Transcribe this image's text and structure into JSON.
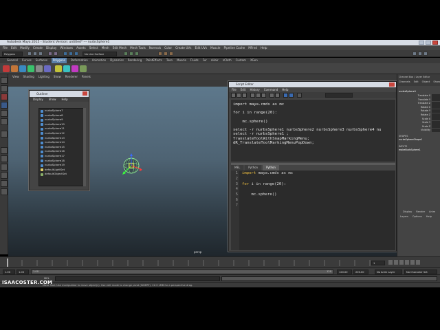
{
  "app": {
    "title": "Autodesk Maya 2015 - Student Version: untitled* --- nurbsSphere1"
  },
  "menubar": [
    "File",
    "Edit",
    "Modify",
    "Create",
    "Display",
    "Windows",
    "Assets",
    "Select",
    "Mesh",
    "Edit Mesh",
    "Mesh Tools",
    "Normals",
    "Color",
    "Create UVs",
    "Edit UVs",
    "Muscle",
    "Pipeline Cache",
    "MFrnd",
    "Help"
  ],
  "statusline": {
    "mode": "Polygons",
    "field_hint": "No Live Surface"
  },
  "shelf_tabs": {
    "items": [
      "General",
      "Curves",
      "Surfaces",
      "Polygons",
      "Deformation",
      "Animation",
      "Dynamics",
      "Rendering",
      "PaintEffects",
      "Toon",
      "Muscle",
      "Fluids",
      "Fur",
      "nHair",
      "nCloth",
      "Custom",
      "XGen"
    ],
    "active_index": 3
  },
  "viewport": {
    "menu": [
      "View",
      "Shading",
      "Lighting",
      "Show",
      "Renderer",
      "Panels"
    ],
    "camera_label": "persp"
  },
  "outliner": {
    "title": "Outliner",
    "menu": [
      "Display",
      "Show",
      "Help"
    ],
    "items": [
      "nurbsSphere7",
      "nurbsSphere8",
      "nurbsSphere9",
      "nurbsSphere10",
      "nurbsSphere11",
      "nurbsSphere12",
      "nurbsSphere13",
      "nurbsSphere14",
      "nurbsSphere15",
      "nurbsSphere16",
      "nurbsSphere17",
      "nurbsSphere18",
      "nurbsSphere19",
      "defaultLightSet",
      "defaultObjectSet"
    ]
  },
  "script_editor": {
    "title": "Script Editor",
    "menu": [
      "File",
      "Edit",
      "History",
      "Command",
      "Help"
    ],
    "history_lines": [
      "import maya.cmds as mc",
      "",
      "for i in range(20):",
      "",
      "    mc.sphere()",
      "",
      "select -r nurbsSphere1 nurbsSphere2 nurbsSphere3 nurbsSphere4 nu",
      "select -r nurbsSphere1 ;",
      "TranslateToolWithSnapMarkingMenu;",
      "dR_TranslateToolMarkingMenuPopDown;"
    ],
    "tabs": [
      "MEL",
      "Python",
      "Python"
    ],
    "active_tab_index": 2,
    "line_numbers": [
      "1",
      "2",
      "3",
      "4",
      "5",
      "6",
      "7"
    ],
    "code_lines": [
      {
        "kw": "import",
        "rest": " maya.cmds as mc"
      },
      {
        "kw": "",
        "rest": ""
      },
      {
        "kw": "for",
        "rest": " i in range(20):"
      },
      {
        "kw": "",
        "rest": ""
      },
      {
        "kw": "",
        "rest": "    mc.sphere()"
      },
      {
        "kw": "",
        "rest": ""
      },
      {
        "kw": "",
        "rest": ""
      }
    ]
  },
  "channel_box": {
    "header": "Channel Box / Layer Editor",
    "menu": [
      "Channels",
      "Edit",
      "Object",
      "Show"
    ],
    "object_name": "nurbsSphere1",
    "attributes": [
      "Translate X",
      "Translate Y",
      "Translate Z",
      "Rotate X",
      "Rotate Y",
      "Rotate Z",
      "Scale X",
      "Scale Y",
      "Scale Z",
      "Visibility"
    ],
    "shapes_label": "SHAPES",
    "shape_name": "nurbsSphereShape1",
    "inputs_label": "INPUTS",
    "input_name": "makeNurbSphere1",
    "layer_menu": [
      "Display",
      "Render",
      "Anim"
    ],
    "layer_submenu": [
      "Layers",
      "Options",
      "Help"
    ]
  },
  "timeslider": {
    "start": "1.00",
    "end": "1.00",
    "range_start": "1.00",
    "range_end": "120.00",
    "anim_end": "200.00",
    "range_left": "1.00",
    "range_left2": "1.00",
    "current_frame": "1",
    "range_mid": "120",
    "anim_layer": "No Anim Layer",
    "char_set": "No Character Set"
  },
  "cmdline": {
    "lang": "MEL"
  },
  "helpline": {
    "text": "Move Tool: Use manipulator to move object(s). Use edit mode to change pivot (INSERT). Ctrl+LMB for a perspective drag."
  },
  "watermark": "ISAACOSTER.COM",
  "colors": {
    "accent": "#5a7fa8",
    "maya_bg": "#444444",
    "keyword": "#f0c040",
    "close": "#c9463d"
  }
}
